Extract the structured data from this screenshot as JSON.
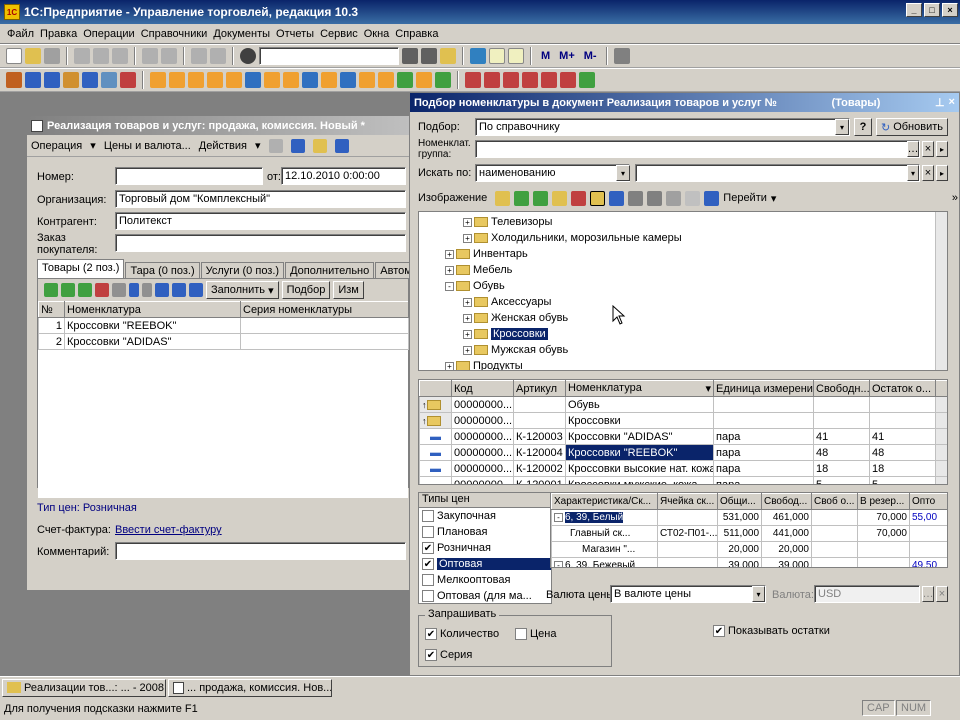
{
  "app": {
    "title": "1С:Предприятие - Управление торговлей, редакция 10.3",
    "icon_text": "1С"
  },
  "menu": [
    "Файл",
    "Правка",
    "Операции",
    "Справочники",
    "Документы",
    "Отчеты",
    "Сервис",
    "Окна",
    "Справка"
  ],
  "toolbar": {
    "m_label": "M",
    "mplus_label": "M+",
    "mminus_label": "M-"
  },
  "doc": {
    "title": "Реализация товаров и услуг: продажа, комиссия. Новый *",
    "toolbar": [
      "Операция",
      "Цены и валюта...",
      "Действия"
    ],
    "number_label": "Номер:",
    "number_value": "",
    "date_label": "от:",
    "date_value": "12.10.2010  0:00:00",
    "org_label": "Организация:",
    "org_value": "Торговый дом \"Комплексный\"",
    "contractor_label": "Контрагент:",
    "contractor_value": "Политекст",
    "order_label": "Заказ покупателя:",
    "order_value": "",
    "tabs": [
      "Товары (2 поз.)",
      "Тара (0 поз.)",
      "Услуги (0 поз.)",
      "Дополнительно",
      "Автомат"
    ],
    "tab_toolbar": {
      "fill": "Заполнить",
      "select": "Подбор",
      "change": "Изм"
    },
    "table_headers": [
      "№",
      "Номенклатура",
      "Серия номенклатуры"
    ],
    "rows": [
      {
        "n": "1",
        "name": "Кроссовки \"REEBOK\"",
        "series": ""
      },
      {
        "n": "2",
        "name": "Кроссовки \"ADIDAS\"",
        "series": ""
      }
    ],
    "price_type_label": "Тип цен: Розничная",
    "invoice_label": "Счет-фактура:",
    "invoice_link": "Ввести счет-фактуру",
    "comment_label": "Комментарий:",
    "comment_value": ""
  },
  "picker": {
    "title": "Подбор номенклатуры в документ Реализация товаров и услуг №",
    "title_right": "(Товары)",
    "select_label": "Подбор:",
    "select_value": "По справочнику",
    "help": "?",
    "refresh": "Обновить",
    "group_label": "Номенклат. группа:",
    "group_value": "",
    "search_label": "Искать по:",
    "search_value": "наименованию",
    "search_text": "",
    "toolbar_image": "Изображение",
    "toolbar_goto": "Перейти",
    "tree": [
      {
        "label": "Телевизоры",
        "level": 2,
        "sign": "+"
      },
      {
        "label": "Холодильники, морозильные камеры",
        "level": 2,
        "sign": "+"
      },
      {
        "label": "Инвентарь",
        "level": 1,
        "sign": "+"
      },
      {
        "label": "Мебель",
        "level": 1,
        "sign": "+"
      },
      {
        "label": "Обувь",
        "level": 1,
        "sign": "-"
      },
      {
        "label": "Аксессуары",
        "level": 2,
        "sign": "+"
      },
      {
        "label": "Женская обувь",
        "level": 2,
        "sign": "+"
      },
      {
        "label": "Кроссовки",
        "level": 2,
        "sign": "+",
        "selected": true
      },
      {
        "label": "Мужская обувь",
        "level": 2,
        "sign": "+"
      },
      {
        "label": "Продукты",
        "level": 1,
        "sign": "+"
      }
    ],
    "grid_headers": [
      "Код",
      "Артикул",
      "Номенклатура",
      "Единица измерения",
      "Свободн...",
      "Остаток о..."
    ],
    "grid_rows": [
      {
        "code": "00000000...",
        "art": "",
        "name": "Обувь",
        "unit": "",
        "free": "",
        "rest": "",
        "folder": true
      },
      {
        "code": "00000000...",
        "art": "",
        "name": "Кроссовки",
        "unit": "",
        "free": "",
        "rest": "",
        "folder": true
      },
      {
        "code": "00000000...",
        "art": "К-120003",
        "name": "Кроссовки \"ADIDAS\"",
        "unit": "пара",
        "free": "41",
        "rest": "41"
      },
      {
        "code": "00000000...",
        "art": "К-120004",
        "name": "Кроссовки \"REEBOK\"",
        "unit": "пара",
        "free": "48",
        "rest": "48",
        "selected": true
      },
      {
        "code": "00000000...",
        "art": "К-120002",
        "name": "Кроссовки высокие нат. кожа",
        "unit": "пара",
        "free": "18",
        "rest": "18"
      },
      {
        "code": "00000000...",
        "art": "К-120001",
        "name": "Кроссовки мужские, кожа",
        "unit": "пара",
        "free": "5",
        "rest": "5"
      }
    ],
    "price_types_header": "Типы цен",
    "price_types": [
      {
        "label": "Закупочная",
        "checked": false
      },
      {
        "label": "Плановая",
        "checked": false
      },
      {
        "label": "Розничная",
        "checked": true
      },
      {
        "label": "Оптовая",
        "checked": true,
        "selected": true
      },
      {
        "label": "Мелкооптовая",
        "checked": false
      },
      {
        "label": "Оптовая (для ма...",
        "checked": false
      }
    ],
    "stock_headers": [
      "Характеристика/Ск...",
      "Ячейка ск...",
      "Общи...",
      "Свобод...",
      "Своб о...",
      "В резер...",
      "Опто"
    ],
    "stock_rows": [
      {
        "c1": "6, 39, Белый",
        "c2": "",
        "c3": "531,000",
        "c4": "461,000",
        "c5": "",
        "c6": "70,000",
        "c7": "55,00",
        "sign": "-",
        "indent": 0,
        "selected": true
      },
      {
        "c1": "Главный ск...",
        "c2": "СТ02-П01-...",
        "c3": "511,000",
        "c4": "441,000",
        "c5": "",
        "c6": "70,000",
        "c7": "",
        "indent": 1
      },
      {
        "c1": "Магазин \"...",
        "c2": "",
        "c3": "20,000",
        "c4": "20,000",
        "c5": "",
        "c6": "",
        "c7": "",
        "indent": 2
      },
      {
        "c1": "6, 39, Бежевый",
        "c2": "",
        "c3": "39,000",
        "c4": "39,000",
        "c5": "",
        "c6": "",
        "c7": "49,50",
        "sign": "-",
        "indent": 0
      }
    ],
    "currency_label": "Валюта цены:",
    "currency_value": "В валюте цены",
    "currency2_label": "Валюта:",
    "currency2_value": "USD",
    "ask_group": "Запрашивать",
    "ask_qty": "Количество",
    "ask_price": "Цена",
    "ask_series": "Серия",
    "show_rest": "Показывать остатки"
  },
  "taskbar": [
    "Реализации тов...: ... - 2008 г.",
    "... продажа, комиссия. Нов..."
  ],
  "status": {
    "text": "Для получения подсказки нажмите F1",
    "cap": "CAP",
    "num": "NUM"
  },
  "colors": {
    "selection": "#0a246a",
    "title_active": "#0a246a",
    "face": "#d4d0c8"
  }
}
